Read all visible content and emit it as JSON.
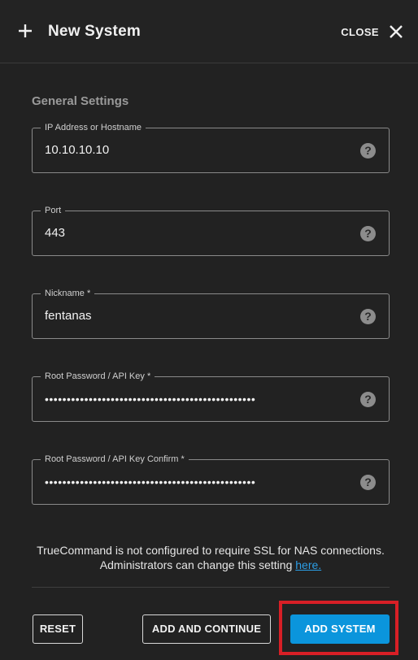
{
  "header": {
    "title": "New System",
    "close_label": "CLOSE"
  },
  "section": {
    "title": "General Settings"
  },
  "fields": [
    {
      "label": "IP Address or Hostname",
      "value": "10.10.10.10"
    },
    {
      "label": "Port",
      "value": "443"
    },
    {
      "label": "Nickname *",
      "value": "fentanas"
    },
    {
      "label": "Root Password / API Key *",
      "value": "••••••••••••••••••••••••••••••••••••••••••••••••"
    },
    {
      "label": "Root Password / API Key Confirm *",
      "value": "••••••••••••••••••••••••••••••••••••••••••••••••"
    }
  ],
  "ssl_note": {
    "text": "TrueCommand is not configured to require SSL for NAS connections. Administrators can change this setting ",
    "link": "here."
  },
  "actions": {
    "reset": "RESET",
    "add_continue": "ADD AND CONTINUE",
    "add_system": "ADD SYSTEM"
  },
  "icons": {
    "add": "plus-icon",
    "close": "close-icon",
    "help": "help-icon",
    "help_glyph": "?"
  },
  "colors": {
    "primary": "#0b95dc",
    "link": "#2c9ee6",
    "highlight": "#d81f26"
  }
}
